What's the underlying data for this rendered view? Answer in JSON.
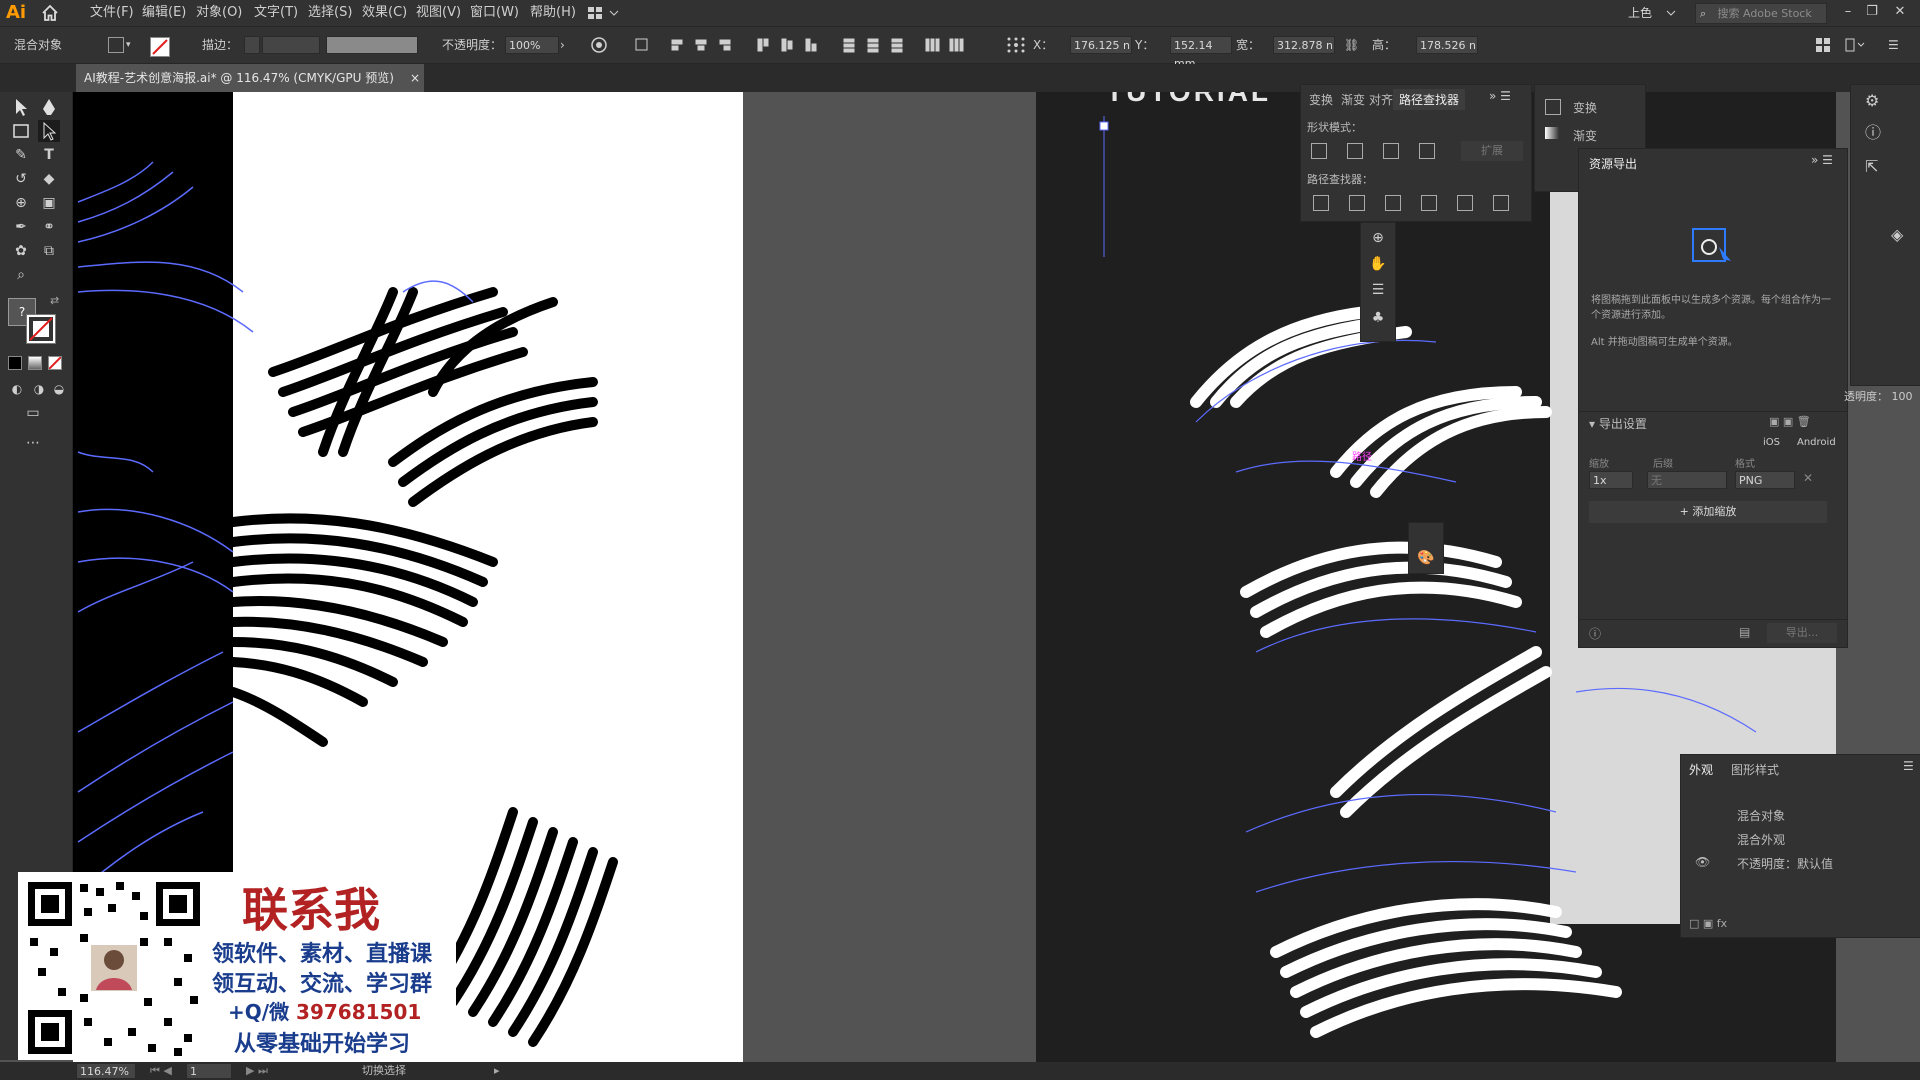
{
  "app": {
    "logo": "Ai",
    "workspace": "上色",
    "stock_search_placeholder": "搜索 Adobe Stock"
  },
  "menu": [
    "文件(F)",
    "编辑(E)",
    "对象(O)",
    "文字(T)",
    "选择(S)",
    "效果(C)",
    "视图(V)",
    "窗口(W)",
    "帮助(H)"
  ],
  "control_bar": {
    "selection_type": "混合对象",
    "stroke_label": "描边：",
    "opacity_label": "不透明度：",
    "opacity_value": "100%",
    "x_label": "X：",
    "x_value": "176.125 n",
    "y_label": "Y：",
    "y_value": "152.14 mm",
    "w_label": "宽：",
    "w_value": "312.878 n",
    "h_label": "高：",
    "h_value": "178.526 n"
  },
  "document_tab": {
    "title": "AI教程-艺术创意海报.ai* @ 116.47% (CMYK/GPU 预览)",
    "close": "×"
  },
  "artboard_right": {
    "heading_fragment": "TUTORIAL"
  },
  "pathfinder_panel": {
    "tabs": [
      "变换",
      "渐变",
      "对齐",
      "路径查找器"
    ],
    "active_tab": "路径查找器",
    "shape_modes_label": "形状模式：",
    "expand_label": "扩展",
    "pathfinders_label": "路径查找器："
  },
  "mini_panel": {
    "items": [
      "变换",
      "渐变"
    ]
  },
  "asset_export": {
    "title": "资源导出",
    "hint1": "将图稿拖到此面板中以生成多个资源。每个组合作为一个资源进行添加。",
    "hint2": "Alt 并拖动图稿可生成单个资源。",
    "export_settings": "导出设置",
    "ios": "iOS",
    "android": "Android",
    "scale_label": "缩放",
    "suffix_label": "后缀",
    "format_label": "格式",
    "scale_value": "1x",
    "suffix_placeholder": "无",
    "format_value": "PNG",
    "add_scale": "添加缩放",
    "export_button": "导出..."
  },
  "appearance_panel": {
    "tabs": [
      "外观",
      "图形样式"
    ],
    "rows": [
      "混合对象",
      "混合外观",
      "不透明度：默认值"
    ]
  },
  "right_strip": {
    "opacity_label": "透明度：",
    "opacity_value": "100"
  },
  "canvas_label": {
    "text": "路径"
  },
  "promo": {
    "title": "联系我",
    "line1": "领软件、素材、直播课",
    "line2": "领互动、交流、学习群",
    "line3_prefix": "+Q/微",
    "line3_number": "397681501",
    "line4": "从零基础开始学习"
  },
  "status_bar": {
    "zoom": "116.47%",
    "page": "1",
    "tool": "切换选择"
  },
  "colors": {
    "accent": "#ff9a00",
    "selection": "#3d5afe",
    "promo_red": "#b22222"
  }
}
